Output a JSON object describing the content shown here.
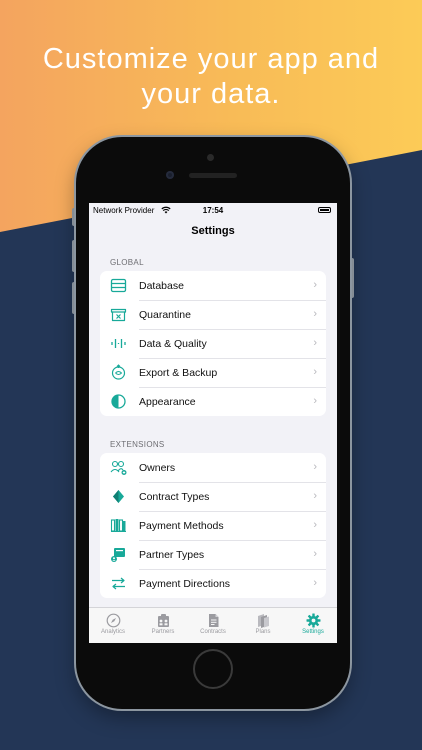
{
  "headline": {
    "line1": "Customize your app and",
    "line2": "your data."
  },
  "colors": {
    "accent": "#18a999",
    "background_navy": "#233656",
    "background_orange": "#f8bb57"
  },
  "status_bar": {
    "carrier": "Network Provider",
    "wifi_icon": "wifi-icon",
    "time": "17:54",
    "battery_icon": "battery-icon"
  },
  "nav": {
    "title": "Settings"
  },
  "global_section": {
    "header": "GLOBAL",
    "items": [
      {
        "label": "Database",
        "icon": "database-icon"
      },
      {
        "label": "Quarantine",
        "icon": "quarantine-icon"
      },
      {
        "label": "Data & Quality",
        "icon": "data-quality-icon"
      },
      {
        "label": "Export & Backup",
        "icon": "export-backup-icon"
      },
      {
        "label": "Appearance",
        "icon": "appearance-icon"
      }
    ]
  },
  "extensions_section": {
    "header": "EXTENSIONS",
    "items": [
      {
        "label": "Owners",
        "icon": "owners-icon"
      },
      {
        "label": "Contract Types",
        "icon": "contract-types-icon"
      },
      {
        "label": "Payment Methods",
        "icon": "payment-methods-icon"
      },
      {
        "label": "Partner Types",
        "icon": "partner-types-icon"
      },
      {
        "label": "Payment Directions",
        "icon": "payment-directions-icon"
      }
    ]
  },
  "tab_bar": {
    "active": "Settings",
    "tabs": [
      {
        "label": "Analytics",
        "icon": "compass-icon"
      },
      {
        "label": "Partners",
        "icon": "partners-icon"
      },
      {
        "label": "Contracts",
        "icon": "document-icon"
      },
      {
        "label": "Plans",
        "icon": "plans-icon"
      },
      {
        "label": "Settings",
        "icon": "gear-icon"
      }
    ]
  }
}
